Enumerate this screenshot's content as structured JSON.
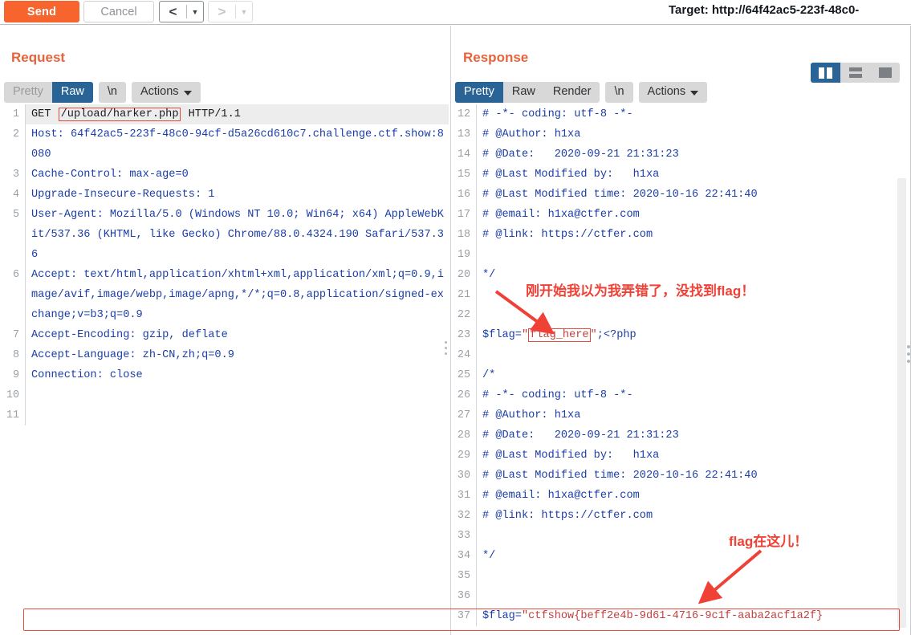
{
  "toolbar": {
    "send_label": "Send",
    "cancel_label": "Cancel",
    "back_arrow": "<",
    "forward_arrow": ">",
    "caret": "▼",
    "target_label": "Target: http://64f42ac5-223f-48c0-"
  },
  "request": {
    "title": "Request",
    "tabs": [
      {
        "label": "Pretty",
        "state": "dim"
      },
      {
        "label": "Raw",
        "state": "active"
      }
    ],
    "newline_tab": "\\n",
    "actions_tab": "Actions",
    "lines": [
      {
        "n": "1",
        "highlight": true,
        "parts": [
          {
            "t": "GET ",
            "cls": "tok-plain"
          },
          {
            "t": "/upload/harker.php",
            "cls": "boxed"
          },
          {
            "t": " HTTP/1.1",
            "cls": "tok-plain"
          }
        ]
      },
      {
        "n": "2",
        "parts": [
          {
            "t": "Host: 64f42ac5-223f-48c0-94cf-d5a26cd610c7.challenge.ctf.show:8080",
            "cls": "tok-blue"
          }
        ]
      },
      {
        "n": "3",
        "parts": [
          {
            "t": "Cache-Control: max-age=0",
            "cls": "tok-blue"
          }
        ]
      },
      {
        "n": "4",
        "parts": [
          {
            "t": "Upgrade-Insecure-Requests: 1",
            "cls": "tok-blue"
          }
        ]
      },
      {
        "n": "5",
        "parts": [
          {
            "t": "User-Agent: Mozilla/5.0 (Windows NT 10.0; Win64; x64) AppleWebKit/537.36 (KHTML, like Gecko) Chrome/88.0.4324.190 Safari/537.36",
            "cls": "tok-blue"
          }
        ]
      },
      {
        "n": "6",
        "parts": [
          {
            "t": "Accept: text/html,application/xhtml+xml,application/xml;q=0.9,image/avif,image/webp,image/apng,*/*;q=0.8,application/signed-exchange;v=b3;q=0.9",
            "cls": "tok-blue"
          }
        ]
      },
      {
        "n": "7",
        "parts": [
          {
            "t": "Accept-Encoding: gzip, deflate",
            "cls": "tok-blue"
          }
        ]
      },
      {
        "n": "8",
        "parts": [
          {
            "t": "Accept-Language: zh-CN,zh;q=0.9",
            "cls": "tok-blue"
          }
        ]
      },
      {
        "n": "9",
        "parts": [
          {
            "t": "Connection: close",
            "cls": "tok-blue"
          }
        ]
      },
      {
        "n": "10",
        "parts": [
          {
            "t": "",
            "cls": "tok-blue"
          }
        ]
      },
      {
        "n": "11",
        "parts": [
          {
            "t": "",
            "cls": "tok-blue"
          }
        ]
      }
    ]
  },
  "response": {
    "title": "Response",
    "tabs": [
      {
        "label": "Pretty",
        "state": "active"
      },
      {
        "label": "Raw",
        "state": "normal"
      },
      {
        "label": "Render",
        "state": "normal"
      }
    ],
    "newline_tab": "\\n",
    "actions_tab": "Actions",
    "layout_buttons": [
      {
        "name": "split-vertical",
        "active": true
      },
      {
        "name": "split-horizontal",
        "active": false
      },
      {
        "name": "single-pane",
        "active": false
      }
    ],
    "lines": [
      {
        "n": "12",
        "parts": [
          {
            "t": "# -*- coding: utf-8 -*-",
            "cls": "tok-blue"
          }
        ]
      },
      {
        "n": "13",
        "parts": [
          {
            "t": "# @Author: h1xa",
            "cls": "tok-blue"
          }
        ]
      },
      {
        "n": "14",
        "parts": [
          {
            "t": "# @Date:   2020-09-21 21:31:23",
            "cls": "tok-blue"
          }
        ]
      },
      {
        "n": "15",
        "parts": [
          {
            "t": "# @Last Modified by:   h1xa",
            "cls": "tok-blue"
          }
        ]
      },
      {
        "n": "16",
        "parts": [
          {
            "t": "# @Last Modified time: 2020-10-16 22:41:40",
            "cls": "tok-blue"
          }
        ]
      },
      {
        "n": "17",
        "parts": [
          {
            "t": "# @email: h1xa@ctfer.com",
            "cls": "tok-blue"
          }
        ]
      },
      {
        "n": "18",
        "parts": [
          {
            "t": "# @link: https://ctfer.com",
            "cls": "tok-blue"
          }
        ]
      },
      {
        "n": "19",
        "parts": [
          {
            "t": "",
            "cls": "tok-blue"
          }
        ]
      },
      {
        "n": "20",
        "parts": [
          {
            "t": "*/",
            "cls": "tok-blue"
          }
        ]
      },
      {
        "n": "21",
        "parts": [
          {
            "t": "",
            "cls": "tok-blue"
          }
        ]
      },
      {
        "n": "22",
        "parts": [
          {
            "t": "",
            "cls": "tok-blue"
          }
        ]
      },
      {
        "n": "23",
        "parts": [
          {
            "t": "$flag=",
            "cls": "tok-blue"
          },
          {
            "t": "\"",
            "cls": "tok-str"
          },
          {
            "t": "flag_here",
            "cls": "boxed-str"
          },
          {
            "t": "\"",
            "cls": "tok-str"
          },
          {
            "t": ";<?php",
            "cls": "tok-blue"
          }
        ]
      },
      {
        "n": "24",
        "parts": [
          {
            "t": "",
            "cls": "tok-blue"
          }
        ]
      },
      {
        "n": "25",
        "parts": [
          {
            "t": "/*",
            "cls": "tok-blue"
          }
        ]
      },
      {
        "n": "26",
        "parts": [
          {
            "t": "# -*- coding: utf-8 -*-",
            "cls": "tok-blue"
          }
        ]
      },
      {
        "n": "27",
        "parts": [
          {
            "t": "# @Author: h1xa",
            "cls": "tok-blue"
          }
        ]
      },
      {
        "n": "28",
        "parts": [
          {
            "t": "# @Date:   2020-09-21 21:31:23",
            "cls": "tok-blue"
          }
        ]
      },
      {
        "n": "29",
        "parts": [
          {
            "t": "# @Last Modified by:   h1xa",
            "cls": "tok-blue"
          }
        ]
      },
      {
        "n": "30",
        "parts": [
          {
            "t": "# @Last Modified time: 2020-10-16 22:41:40",
            "cls": "tok-blue"
          }
        ]
      },
      {
        "n": "31",
        "parts": [
          {
            "t": "# @email: h1xa@ctfer.com",
            "cls": "tok-blue"
          }
        ]
      },
      {
        "n": "32",
        "parts": [
          {
            "t": "# @link: https://ctfer.com",
            "cls": "tok-blue"
          }
        ]
      },
      {
        "n": "33",
        "parts": [
          {
            "t": "",
            "cls": "tok-blue"
          }
        ]
      },
      {
        "n": "34",
        "parts": [
          {
            "t": "*/",
            "cls": "tok-blue"
          }
        ]
      },
      {
        "n": "35",
        "parts": [
          {
            "t": "",
            "cls": "tok-blue"
          }
        ]
      },
      {
        "n": "36",
        "parts": [
          {
            "t": "",
            "cls": "tok-blue"
          }
        ]
      },
      {
        "n": "37",
        "parts": [
          {
            "t": "$flag=",
            "cls": "tok-blue"
          },
          {
            "t": "\"ctfshow{beff2e4b-9d61-4716-9c1f-aaba2acf1a2f}",
            "cls": "tok-str"
          }
        ]
      }
    ]
  },
  "annotations": [
    {
      "text": "刚开始我以为我弄错了，没找到flag！"
    },
    {
      "text": "flag在这儿！"
    }
  ],
  "colors": {
    "accent_orange": "#f7642d",
    "title_orange": "#e8633a",
    "tab_active_blue": "#2a6496",
    "code_blue": "#1b3ea8",
    "code_red": "#c04040",
    "annotation_red": "#ef4136"
  }
}
